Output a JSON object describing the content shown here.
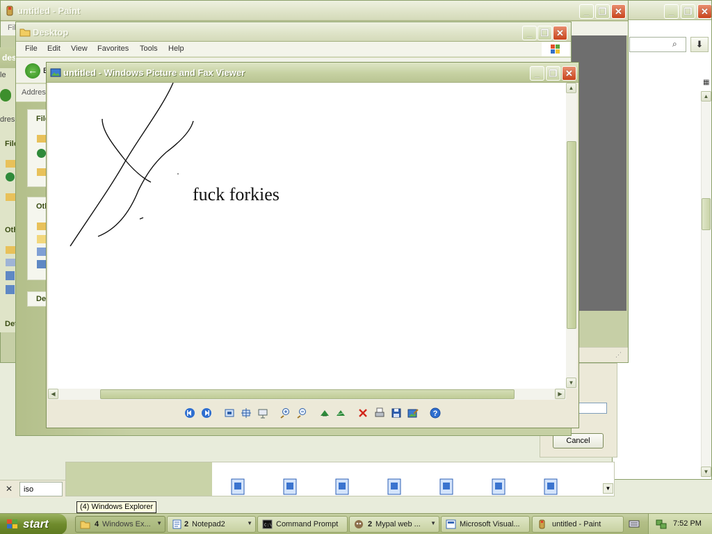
{
  "paint_window": {
    "title": "untitled - Paint",
    "partial_menu": "Fil"
  },
  "right_window": {
    "cancel_label": "Cancel"
  },
  "explorer_back_left": {
    "fragments": [
      "des",
      "le",
      "Addres",
      "dres",
      "File",
      "Othe",
      "Det",
      "File",
      "Oth",
      "Det"
    ]
  },
  "explorer_window": {
    "title": "Desktop",
    "menu": [
      "File",
      "Edit",
      "View",
      "Favorites",
      "Tools",
      "Help"
    ],
    "back_label": "B",
    "address_label": "Addres"
  },
  "viewer_window": {
    "title": "untitled - Windows Picture and Fax Viewer",
    "image_text": "fuck forkies",
    "toolbar_icons": [
      "previous-image-icon",
      "next-image-icon",
      "best-fit-icon",
      "actual-size-icon",
      "slideshow-icon",
      "zoom-in-icon",
      "zoom-out-icon",
      "rotate-clockwise-icon",
      "rotate-counterclockwise-icon",
      "delete-icon",
      "print-icon",
      "save-icon",
      "open-for-editing-icon",
      "help-icon"
    ]
  },
  "search_bar": {
    "value": "iso"
  },
  "tooltip": {
    "text": "(4) Windows Explorer"
  },
  "taskbar": {
    "start_label": "start",
    "tasks": [
      {
        "count": "4",
        "label": "Windows Ex..."
      },
      {
        "count": "2",
        "label": "Notepad2"
      },
      {
        "count": "",
        "label": "Command Prompt"
      },
      {
        "count": "2",
        "label": "Mypal web ..."
      },
      {
        "count": "",
        "label": "Microsoft Visual..."
      },
      {
        "count": "",
        "label": "untitled - Paint"
      }
    ],
    "clock": "7:52 PM"
  },
  "colors": {
    "xp_olive": "#b9c593",
    "close_red": "#c9441c",
    "start_green": "#6f8b2c"
  }
}
